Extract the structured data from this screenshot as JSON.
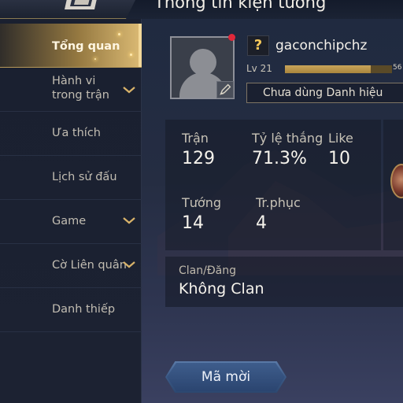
{
  "header": {
    "title": "Thông tin kiện tướng"
  },
  "sidebar": {
    "items": [
      {
        "label": "Tổng quan",
        "active": true,
        "has_chevron": false
      },
      {
        "label": "Hành vi\ntrong trận",
        "active": false,
        "has_chevron": true
      },
      {
        "label": "Ưa thích",
        "active": false,
        "has_chevron": false
      },
      {
        "label": "Lịch sử đấu",
        "active": false,
        "has_chevron": false
      },
      {
        "label": "Game",
        "active": false,
        "has_chevron": true
      },
      {
        "label": "Cờ Liên quân",
        "active": false,
        "has_chevron": true
      },
      {
        "label": "Danh thiếp",
        "active": false,
        "has_chevron": false
      }
    ]
  },
  "profile": {
    "rank_icon": "?",
    "name": "gaconchipchz",
    "level": "Lv 21",
    "xp_text": "56",
    "xp_fraction": 0.8,
    "title_label": "Chưa dùng Danh hiệu"
  },
  "stats": {
    "matches": {
      "label": "Trận",
      "value": "129"
    },
    "win_rate": {
      "label": "Tỷ lệ thắng",
      "value": "71.3%"
    },
    "likes": {
      "label": "Like",
      "value": "10"
    },
    "heroes": {
      "label": "Tướng",
      "value": "14"
    },
    "skins": {
      "label": "Tr.phục",
      "value": "4"
    }
  },
  "clan": {
    "label": "Clan/Đăng",
    "value": "Không Clan"
  },
  "invite": {
    "label": "Mã mời"
  },
  "colors": {
    "accent_gold": "#d9b36a",
    "notification": "#e0283a",
    "button_blue": "#3c5a86"
  }
}
